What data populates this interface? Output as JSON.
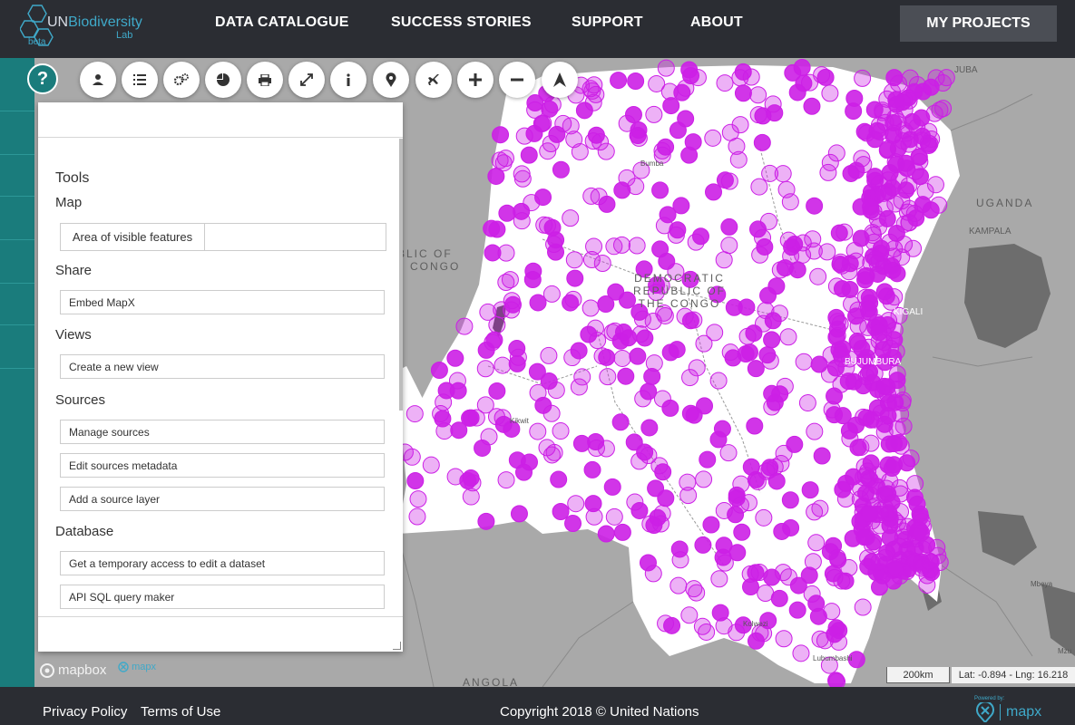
{
  "header": {
    "logo": {
      "un": "UN",
      "word": "Biodiversity",
      "lab": "Lab",
      "beta": "beta"
    },
    "nav": [
      {
        "label": "DATA CATALOGUE"
      },
      {
        "label": "SUCCESS STORIES"
      },
      {
        "label": "SUPPORT"
      },
      {
        "label": "ABOUT"
      }
    ],
    "my_projects": "MY PROJECTS"
  },
  "help_label": "?",
  "toolbar": [
    {
      "icon": "user-icon"
    },
    {
      "icon": "list-icon"
    },
    {
      "icon": "settings-icon"
    },
    {
      "icon": "pie-chart-icon"
    },
    {
      "icon": "print-icon"
    },
    {
      "icon": "fullscreen-icon"
    },
    {
      "icon": "info-icon"
    },
    {
      "icon": "map-marker-icon"
    },
    {
      "icon": "airplane-icon"
    },
    {
      "icon": "zoom-in-icon"
    },
    {
      "icon": "zoom-out-icon"
    },
    {
      "icon": "north-arrow-icon"
    }
  ],
  "panel": {
    "title": "Tools",
    "sections": {
      "map": "Map",
      "share": "Share",
      "views": "Views",
      "sources": "Sources",
      "database": "Database"
    },
    "area_label": "Area of visible features",
    "area_value": "",
    "embed": "Embed MapX",
    "new_view": "Create a new view",
    "manage_sources": "Manage sources",
    "edit_metadata": "Edit sources metadata",
    "add_layer": "Add a source layer",
    "temp_access": "Get a temporary access to edit a dataset",
    "sql_maker": "API SQL query maker"
  },
  "map": {
    "labels": {
      "drc": [
        "DEMOCRATIC",
        "REPUBLIC OF",
        "THE CONGO"
      ],
      "congo": [
        "BLIC OF",
        "CONGO"
      ],
      "uganda": "UGANDA",
      "kampala": "KAMPALA",
      "kigali": "KIGALI",
      "bujumbura": "BUJUMBURA",
      "juba": "JUBA",
      "angola": "ANGOLA",
      "mbeya": "Mbeya",
      "mzuzu": "Mzu",
      "bumba": "Bumba",
      "kikwit": "Kikwit",
      "kolwezi": "Kolwezi",
      "lubumbashi": "Lubumbashi"
    },
    "attribution": {
      "mapbox": "mapbox",
      "mapx": "mapx"
    },
    "scale": "200km",
    "latlng": "Lat: -0.894 - Lng: 16.218",
    "point_color": "#cc1fe6",
    "country_fill": "#ffffff",
    "background_fill": "#a9a9a9"
  },
  "footer": {
    "privacy": "Privacy Policy",
    "terms": "Terms of Use",
    "copyright": "Copyright 2018 © United Nations",
    "powered": "Powered by:",
    "mapx": "mapx"
  },
  "colors": {
    "header": "#2b2d33",
    "rail": "#1a7c7c",
    "accent": "#3fa9c9"
  }
}
